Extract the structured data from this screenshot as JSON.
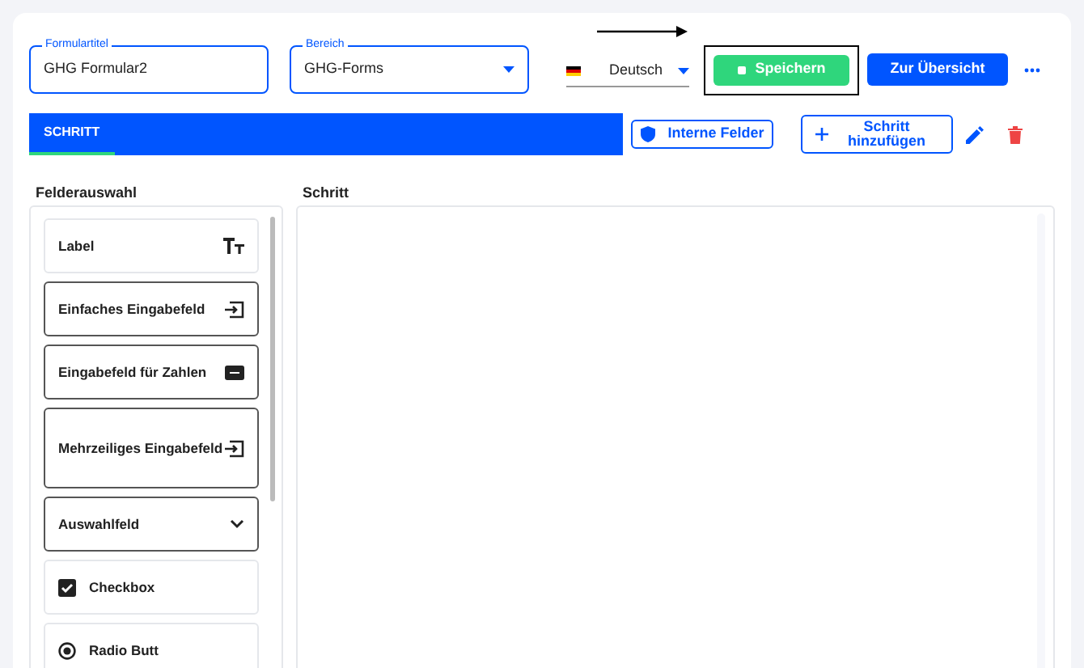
{
  "form_title": {
    "label": "Formulartitel",
    "value": "GHG Formular2"
  },
  "area": {
    "label": "Bereich",
    "value": "GHG-Forms"
  },
  "language": {
    "value": "Deutsch"
  },
  "save_button": {
    "label": "Speichern",
    "highlighted": true
  },
  "overview_button": {
    "label": "Zur Übersicht"
  },
  "tabs": [
    {
      "label": "SCHRITT",
      "selected": true
    }
  ],
  "internal_fields_button": {
    "label": "Interne Felder"
  },
  "add_step_button": {
    "label": "Schritt hinzufügen"
  },
  "field_palette": {
    "title": "Felderauswahl",
    "items": [
      {
        "label": "Label",
        "kind": "text"
      },
      {
        "label": "Einfaches Eingabefeld",
        "kind": "input"
      },
      {
        "label": "Eingabefeld für Zahlen",
        "kind": "number"
      },
      {
        "label": "Mehrzeiliges Eingabefeld",
        "kind": "multiline"
      },
      {
        "label": "Auswahlfeld",
        "kind": "select"
      },
      {
        "label": "Checkbox",
        "kind": "checkbox"
      },
      {
        "label": "Radio Butt",
        "kind": "radio"
      }
    ]
  },
  "step_panel": {
    "title": "Schritt"
  }
}
